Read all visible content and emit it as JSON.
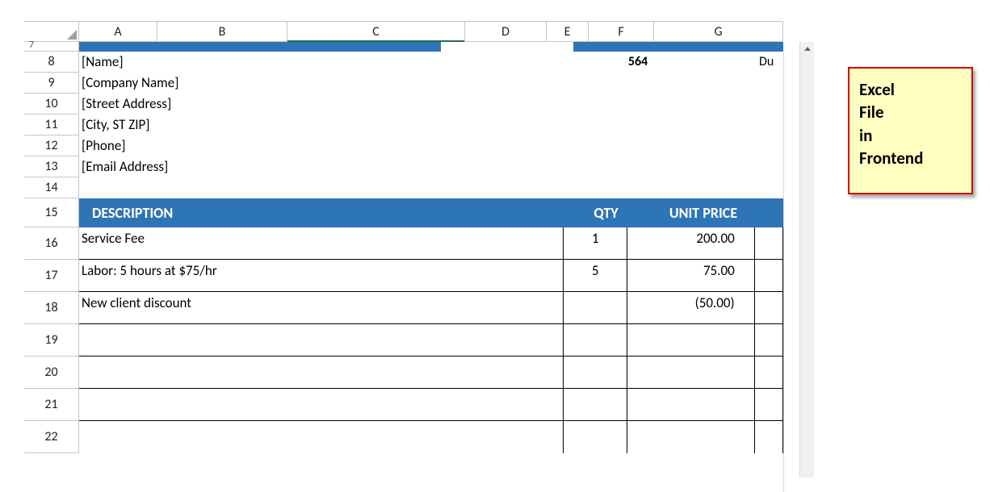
{
  "columns": [
    "A",
    "B",
    "C",
    "D",
    "E",
    "F",
    "G"
  ],
  "active_column": "C",
  "row_numbers_top_partial": "7",
  "row_numbers": [
    8,
    9,
    10,
    11,
    12,
    13,
    14,
    15,
    16,
    17,
    18,
    19,
    20,
    21,
    22
  ],
  "row15_height": 36,
  "tall_rows": [
    16,
    17,
    18,
    19,
    20,
    21,
    22
  ],
  "bill_to": {
    "name": "[Name]",
    "company": "[Company Name]",
    "street": "[Street Address]",
    "city": "[City, ST  ZIP]",
    "phone": "[Phone]",
    "email": "[Email Address]"
  },
  "header_value": "564",
  "header_cut": "Du",
  "table": {
    "headers": {
      "desc": "DESCRIPTION",
      "qty": "QTY",
      "price": "UNIT PRICE"
    },
    "rows": [
      {
        "desc": "Service Fee",
        "qty": "1",
        "price": "200.00"
      },
      {
        "desc": "Labor: 5 hours at $75/hr",
        "qty": "5",
        "price": "75.00"
      },
      {
        "desc": "New client discount",
        "qty": "",
        "price": "(50.00)"
      },
      {
        "desc": "",
        "qty": "",
        "price": ""
      },
      {
        "desc": "",
        "qty": "",
        "price": ""
      },
      {
        "desc": "",
        "qty": "",
        "price": ""
      },
      {
        "desc": "",
        "qty": "",
        "price": ""
      }
    ]
  },
  "sticky": {
    "line1": "Excel",
    "line2": "File",
    "line3": "in",
    "line4": "Frontend"
  }
}
